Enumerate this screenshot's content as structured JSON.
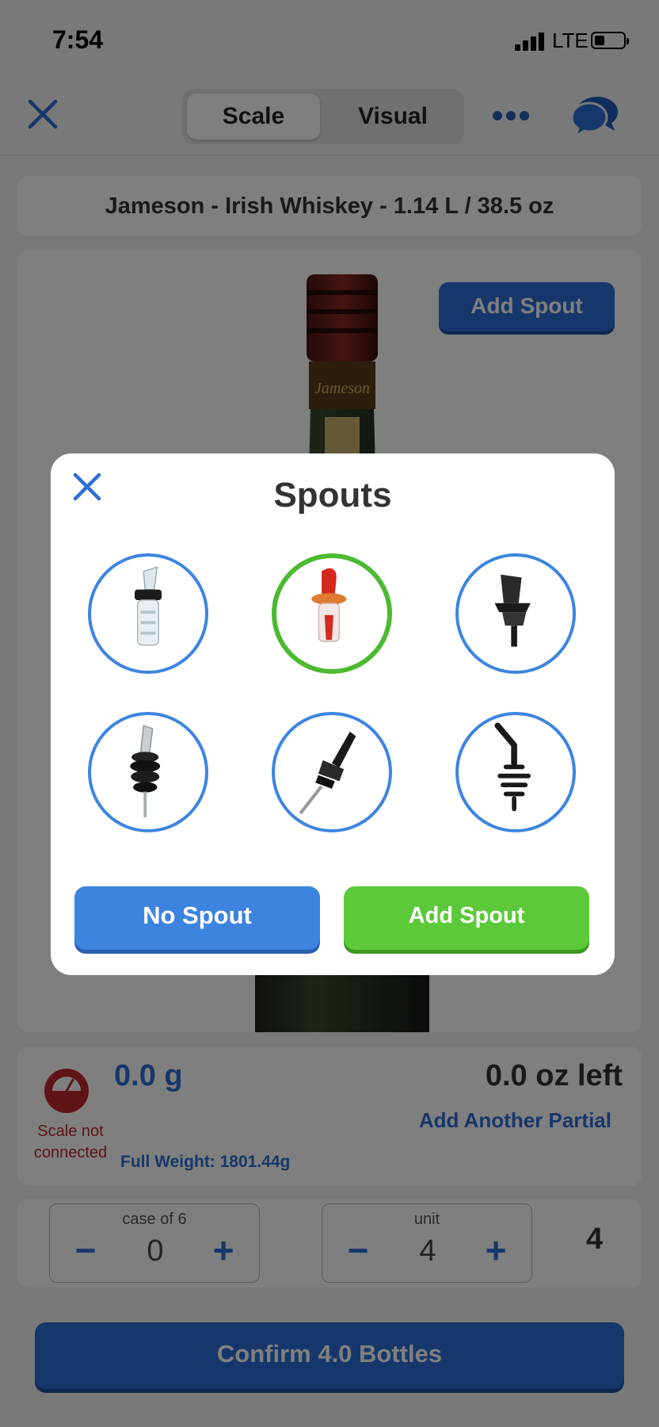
{
  "status_bar": {
    "time": "7:54",
    "network": "LTE"
  },
  "nav": {
    "tabs": [
      {
        "label": "Scale",
        "active": true
      },
      {
        "label": "Visual",
        "active": false
      }
    ]
  },
  "product": {
    "title": "Jameson - Irish Whiskey - 1.14 L / 38.5 oz"
  },
  "bottle_card": {
    "add_spout_label": "Add Spout"
  },
  "weight": {
    "scale_status": "Scale not connected",
    "grams": "0.0 g",
    "oz_left": "0.0 oz left",
    "add_partial_label": "Add Another Partial",
    "full_weight": "Full Weight: 1801.44g"
  },
  "counts": {
    "case": {
      "label": "case of 6",
      "value": "0"
    },
    "unit": {
      "label": "unit",
      "value": "4"
    },
    "total": "4"
  },
  "confirm_label": "Confirm 4.0 Bottles",
  "modal": {
    "title": "Spouts",
    "spouts": [
      {
        "icon": "clear-pourer-spout-icon",
        "selected": false
      },
      {
        "icon": "red-pourer-spout-icon",
        "selected": true
      },
      {
        "icon": "black-tapered-spout-icon",
        "selected": false
      },
      {
        "icon": "steel-spout-cork-icon",
        "selected": false
      },
      {
        "icon": "black-long-spout-icon",
        "selected": false
      },
      {
        "icon": "spout-outline-icon",
        "selected": false
      }
    ],
    "no_spout_label": "No Spout",
    "add_spout_label": "Add Spout"
  },
  "colors": {
    "primary_blue": "#2c6fd6",
    "selected_green": "#4cba31",
    "add_green": "#5cc93a",
    "error_red": "#c0282d"
  }
}
